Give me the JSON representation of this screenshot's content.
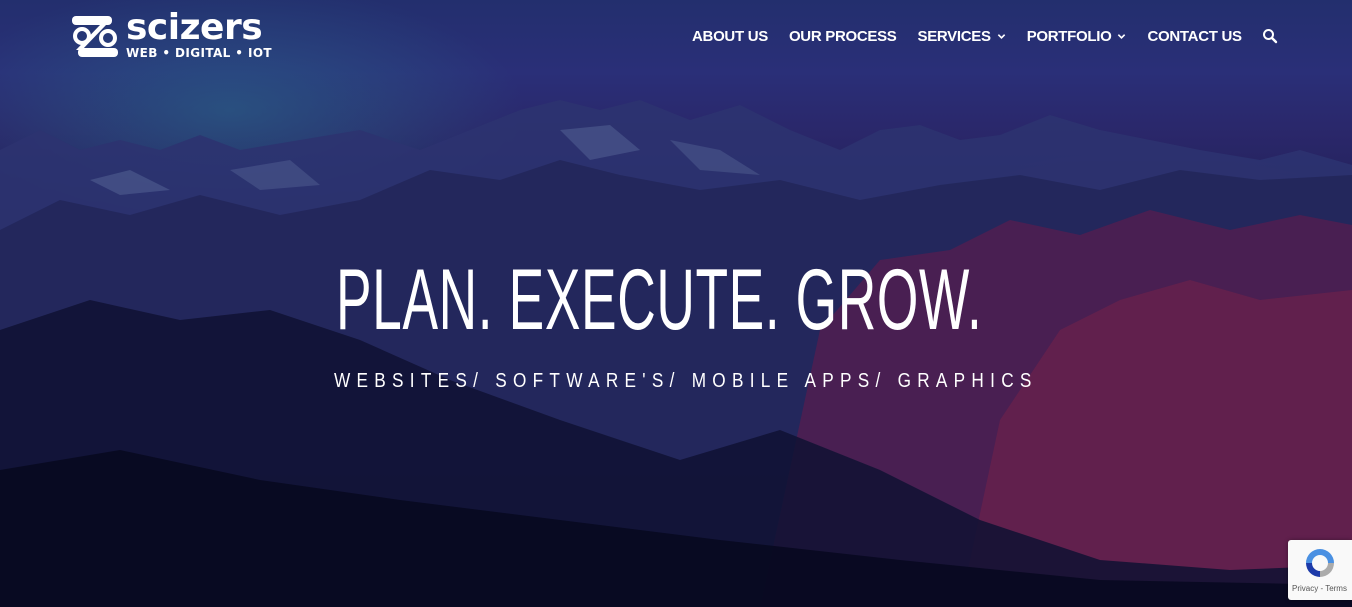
{
  "brand": {
    "name": "scizers",
    "tagline": "WEB • DIGITAL • IOT"
  },
  "nav": {
    "items": [
      {
        "label": "ABOUT US",
        "has_dropdown": false
      },
      {
        "label": "OUR PROCESS",
        "has_dropdown": false
      },
      {
        "label": "SERVICES",
        "has_dropdown": true
      },
      {
        "label": "PORTFOLIO",
        "has_dropdown": true
      },
      {
        "label": "CONTACT US",
        "has_dropdown": false
      }
    ],
    "search_icon": "search-icon"
  },
  "hero": {
    "headline": "PLAN. EXECUTE. GROW.",
    "subline": "WEBSITES/ SOFTWARE'S/ MOBILE APPS/ GRAPHICS"
  },
  "recaptcha": {
    "links": "Privacy - Terms"
  },
  "colors": {
    "text": "#ffffff",
    "sky_top": "#232f6e",
    "sky_bottom": "#0b0c24",
    "accent_red": "#962046"
  }
}
